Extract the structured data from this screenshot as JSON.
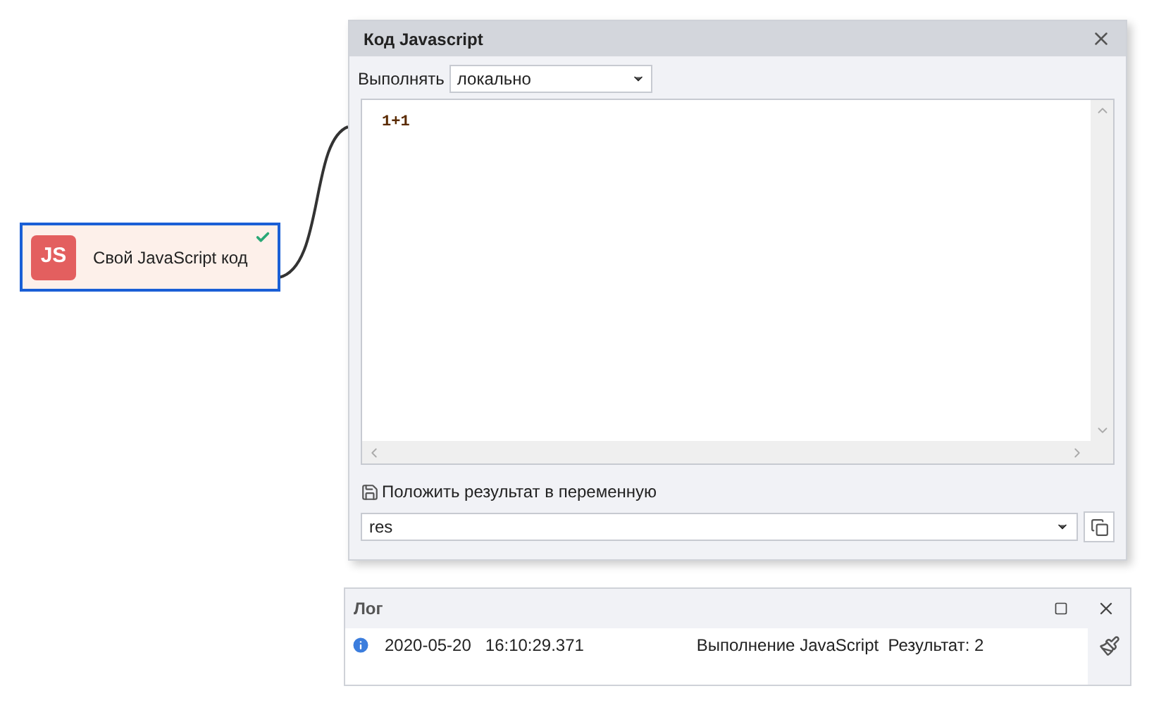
{
  "node": {
    "badge": "JS",
    "label": "Свой JavaScript код",
    "ok": true,
    "selected": true
  },
  "dialog": {
    "title": "Код Javascript",
    "run_label": "Выполнять",
    "run_value": "локально",
    "code": "1+1",
    "save_label": "Положить результат в переменную",
    "variable": "res"
  },
  "log": {
    "title": "Лог",
    "entries": [
      {
        "kind": "info",
        "date": "2020-05-20",
        "time": "16:10:29.371",
        "message": "Выполнение JavaScript  Результат: 2"
      }
    ]
  }
}
